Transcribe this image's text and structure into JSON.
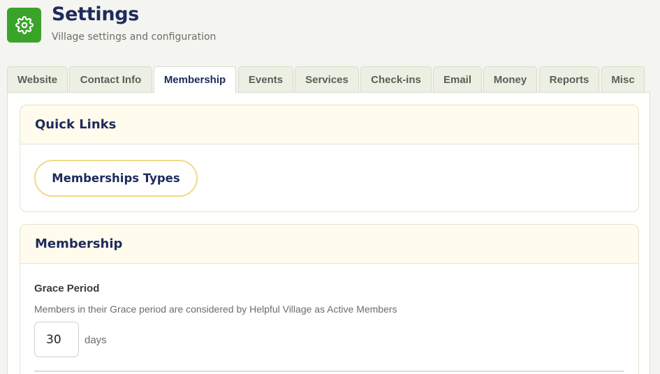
{
  "header": {
    "title": "Settings",
    "subtitle": "Village settings and configuration",
    "icon": "gear-icon",
    "icon_color": "#3aa32a"
  },
  "tabs": [
    {
      "label": "Website"
    },
    {
      "label": "Contact Info"
    },
    {
      "label": "Membership",
      "active": true
    },
    {
      "label": "Events"
    },
    {
      "label": "Services"
    },
    {
      "label": "Check-ins"
    },
    {
      "label": "Email"
    },
    {
      "label": "Money"
    },
    {
      "label": "Reports"
    },
    {
      "label": "Misc"
    }
  ],
  "quick_links": {
    "title": "Quick Links",
    "memberships_types_label": "Memberships Types"
  },
  "membership": {
    "title": "Membership",
    "grace_period": {
      "label": "Grace Period",
      "help": "Members in their Grace period are considered by Helpful Village as Active Members",
      "value": "30",
      "unit": "days"
    }
  },
  "colors": {
    "accent": "#1f2a5c",
    "brand_green": "#3aa32a",
    "button_border": "#efd98a",
    "card_header_bg": "#fffbed"
  }
}
